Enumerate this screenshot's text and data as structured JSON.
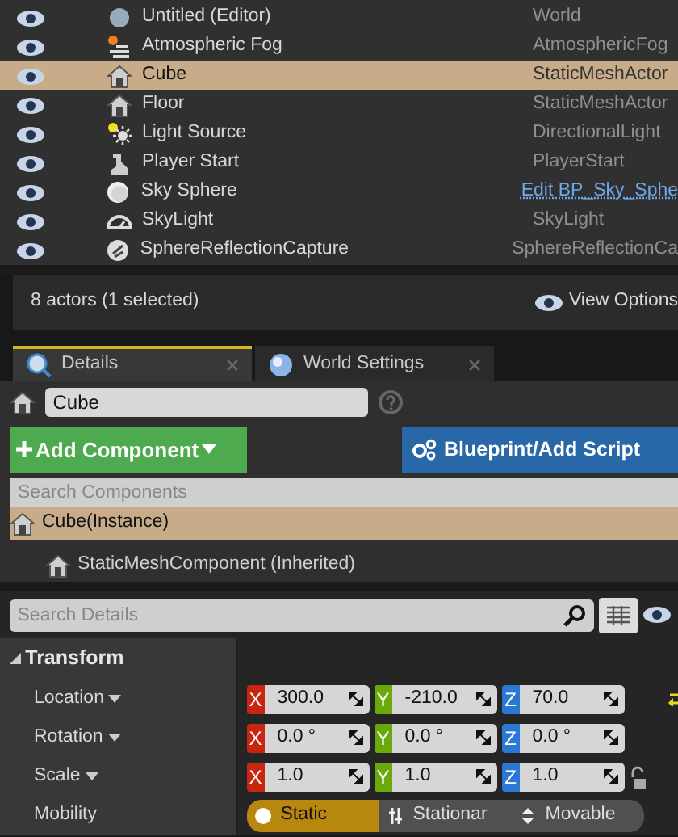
{
  "outliner": {
    "rows": [
      {
        "label": "Untitled (Editor)",
        "type": "World",
        "kind": "text",
        "selected": false
      },
      {
        "label": "Atmospheric Fog",
        "type": "AtmosphericFog",
        "kind": "text",
        "selected": false
      },
      {
        "label": "Cube",
        "type": "StaticMeshActor",
        "kind": "text",
        "selected": true
      },
      {
        "label": "Floor",
        "type": "StaticMeshActor",
        "kind": "text",
        "selected": false
      },
      {
        "label": "Light Source",
        "type": "DirectionalLight",
        "kind": "text",
        "selected": false
      },
      {
        "label": "Player Start",
        "type": "PlayerStart",
        "kind": "text",
        "selected": false
      },
      {
        "label": "Sky Sphere",
        "type": "Edit BP_Sky_Sphe",
        "kind": "link",
        "selected": false
      },
      {
        "label": "SkyLight",
        "type": "SkyLight",
        "kind": "text",
        "selected": false
      },
      {
        "label": "SphereReflectionCapture",
        "type": "SphereReflectionCa",
        "kind": "text",
        "selected": false
      }
    ]
  },
  "status_bar": {
    "count": "8 actors (1 selected)",
    "view_options": "View Options"
  },
  "tabs": [
    {
      "label": "Details",
      "selected": true
    },
    {
      "label": "World Settings",
      "selected": false
    }
  ],
  "name_field": {
    "value": "Cube"
  },
  "add_component": {
    "label": "Add Component"
  },
  "blueprint_button": {
    "label": "Blueprint/Add Script"
  },
  "search_components": {
    "placeholder": "Search Components"
  },
  "components": [
    {
      "label": "Cube(Instance)",
      "selected": true,
      "children": [
        {
          "label": "StaticMeshComponent (Inherited)",
          "selected": false
        }
      ]
    }
  ],
  "search_details": {
    "placeholder": "Search Details"
  },
  "transform": {
    "title": "Transform",
    "expanded": true,
    "properties": [
      {
        "kind": "vector",
        "label": "Location",
        "fields": [
          {
            "axis": "X",
            "value": "300.0"
          },
          {
            "axis": "Y",
            "value": "-210.0"
          },
          {
            "axis": "Z",
            "value": "70.0"
          }
        ],
        "resettable": true
      },
      {
        "kind": "vector",
        "label": "Rotation",
        "fields": [
          {
            "axis": "X",
            "value": "0.0 °"
          },
          {
            "axis": "Y",
            "value": "0.0 °"
          },
          {
            "axis": "Z",
            "value": "0.0 °"
          }
        ],
        "resettable": false
      },
      {
        "kind": "vector",
        "label": "Scale",
        "fields": [
          {
            "axis": "X",
            "value": "1.0"
          },
          {
            "axis": "Y",
            "value": "1.0"
          },
          {
            "axis": "Z",
            "value": "1.0"
          }
        ],
        "resettable": false,
        "locked": false
      },
      {
        "kind": "choice",
        "label": "Mobility",
        "options": [
          {
            "label": "Static",
            "selected": true
          },
          {
            "label": "Stationar",
            "selected": false
          },
          {
            "label": "Movable",
            "selected": false
          }
        ]
      }
    ]
  }
}
